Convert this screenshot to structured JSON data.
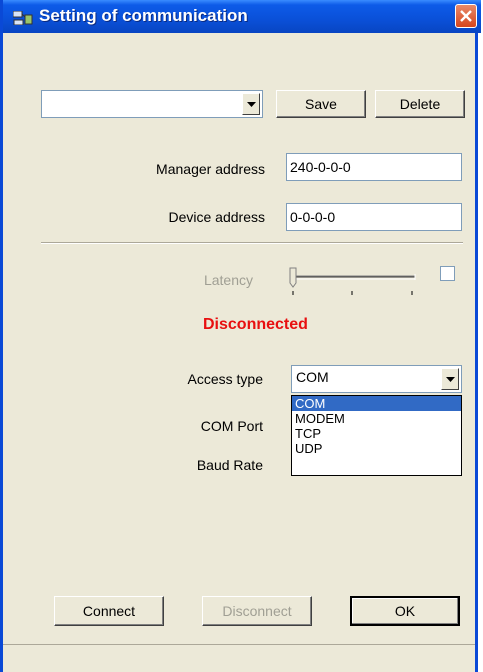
{
  "window": {
    "title": "Setting of communication"
  },
  "profile": {
    "value": "",
    "save_label": "Save",
    "delete_label": "Delete"
  },
  "manager": {
    "label": "Manager address",
    "value": "240-0-0-0"
  },
  "device": {
    "label": "Device address",
    "value": "0-0-0-0"
  },
  "latency": {
    "label": "Latency",
    "checked": false
  },
  "status": {
    "text": "Disconnected",
    "color": "#e81010"
  },
  "access_type": {
    "label": "Access type",
    "value": "COM",
    "options": [
      "COM",
      "MODEM",
      "TCP",
      "UDP"
    ],
    "selected_index": 0
  },
  "com_port": {
    "label": "COM Port"
  },
  "baud_rate": {
    "label": "Baud Rate"
  },
  "footer": {
    "connect_label": "Connect",
    "disconnect_label": "Disconnect",
    "ok_label": "OK"
  },
  "colors": {
    "titlebar": "#0a50d8",
    "window_bg": "#ECE9D8",
    "selection": "#316ac5"
  }
}
